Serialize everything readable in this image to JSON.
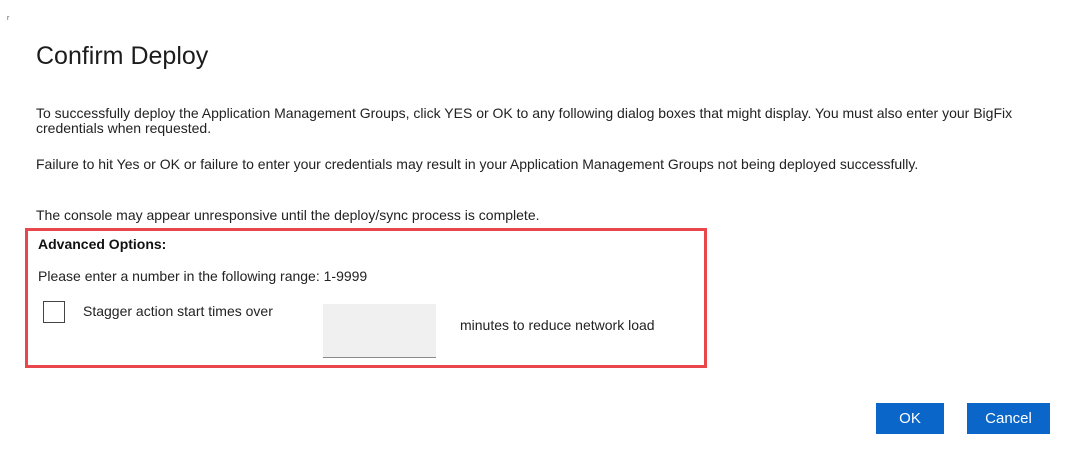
{
  "dialog": {
    "corner_mark": "r",
    "title": "Confirm Deploy",
    "paragraphs": [
      "To successfully deploy the Application Management Groups, click YES or OK to any following dialog boxes that might display. You must also enter your BigFix credentials when requested.",
      "Failure to hit Yes or OK or failure to enter your credentials may result in your Application Management Groups not being deployed successfully.",
      "The console may appear unresponsive until the deploy/sync process is complete."
    ]
  },
  "advanced": {
    "heading": "Advanced Options:",
    "range_text": "Please enter a number in the following range: 1-9999",
    "stagger": {
      "checked": false,
      "label": "Stagger action start times over",
      "minutes_value": "",
      "minutes_placeholder": "",
      "suffix": "minutes to reduce network load"
    },
    "highlight_color": "#e8474c"
  },
  "buttons": {
    "ok_label": "OK",
    "cancel_label": "Cancel",
    "primary_color": "#0a66c8"
  }
}
